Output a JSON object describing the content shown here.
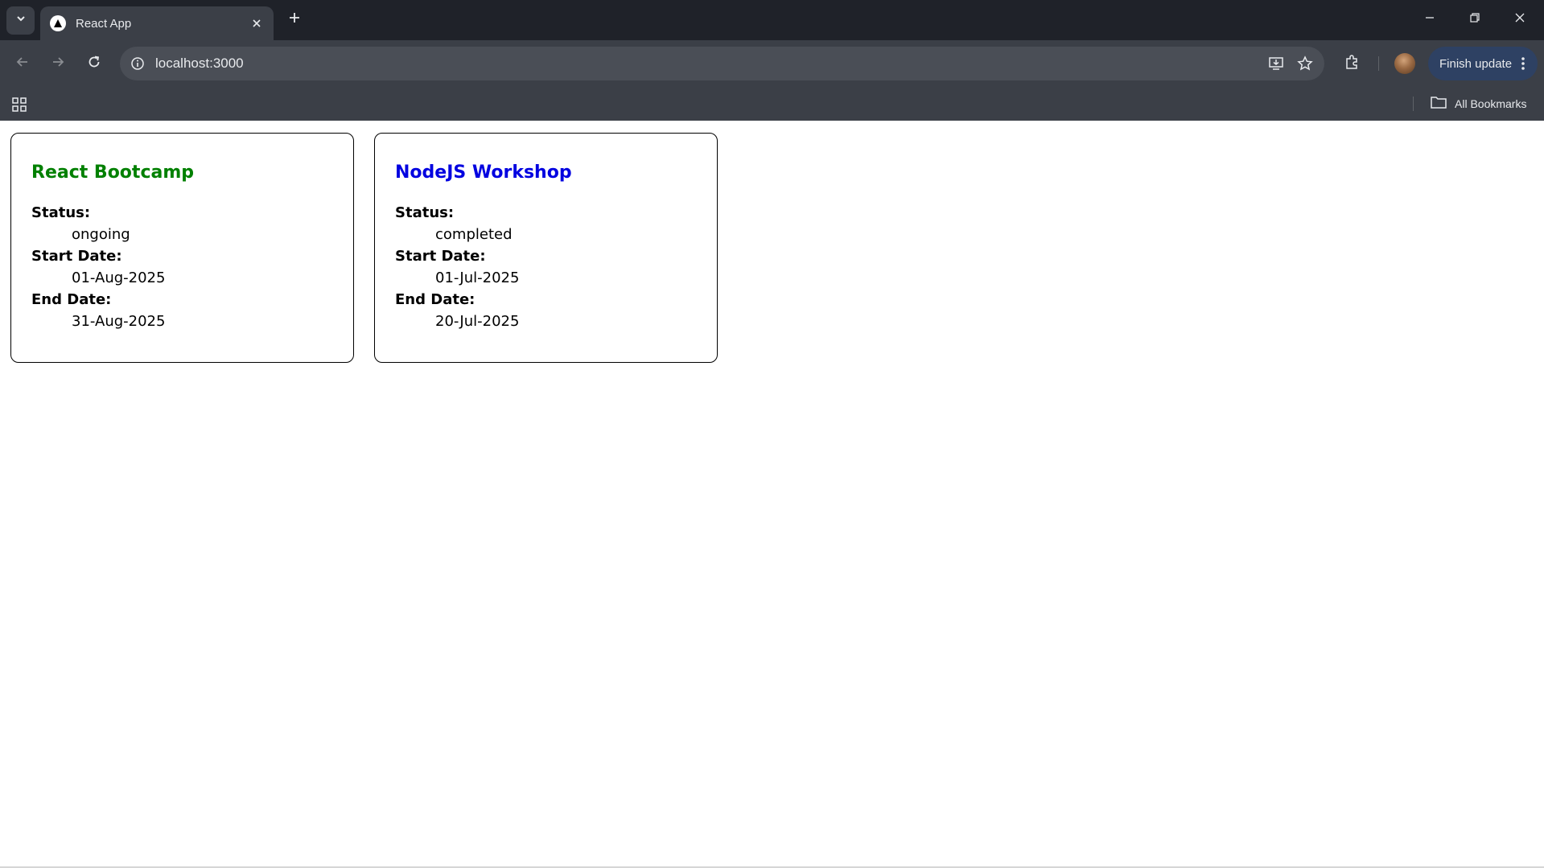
{
  "browser": {
    "tab": {
      "title": "React App"
    },
    "url": "localhost:3000",
    "finish_update_label": "Finish update",
    "all_bookmarks_label": "All Bookmarks"
  },
  "cards": [
    {
      "title": "React Bootcamp",
      "title_color": "#008000",
      "status_label": "Status:",
      "status": "ongoing",
      "start_label": "Start Date:",
      "start_date": "01-Aug-2025",
      "end_label": "End Date:",
      "end_date": "31-Aug-2025"
    },
    {
      "title": "NodeJS Workshop",
      "title_color": "#0000e0",
      "status_label": "Status:",
      "status": "completed",
      "start_label": "Start Date:",
      "start_date": "01-Jul-2025",
      "end_label": "End Date:",
      "end_date": "20-Jul-2025"
    }
  ]
}
